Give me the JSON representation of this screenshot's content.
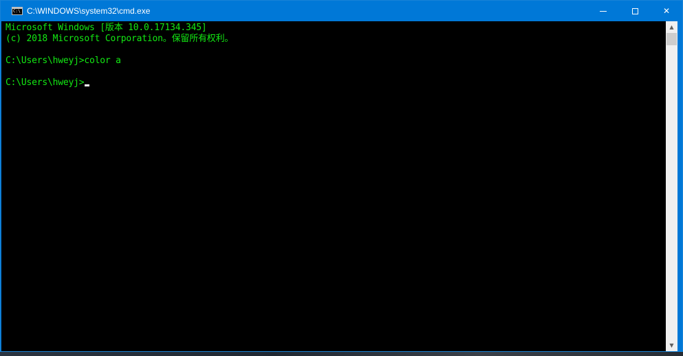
{
  "window": {
    "title": "C:\\WINDOWS\\system32\\cmd.exe",
    "icon": "cmd-console-icon",
    "icon_text": "C:\\"
  },
  "caption_buttons": {
    "minimize": "minimize-icon",
    "maximize": "maximize-icon",
    "close": "✕"
  },
  "console": {
    "text_color": "#13e913",
    "background": "#000000",
    "lines": [
      "Microsoft Windows [版本 10.0.17134.345]",
      "(c) 2018 Microsoft Corporation。保留所有权利。",
      "",
      "C:\\Users\\hweyj>color a",
      "",
      "C:\\Users\\hweyj>"
    ]
  },
  "scrollbar": {
    "up_arrow": "▲",
    "down_arrow": "▼"
  },
  "colors": {
    "titlebar": "#0078d7",
    "title_text": "#ffffff"
  }
}
